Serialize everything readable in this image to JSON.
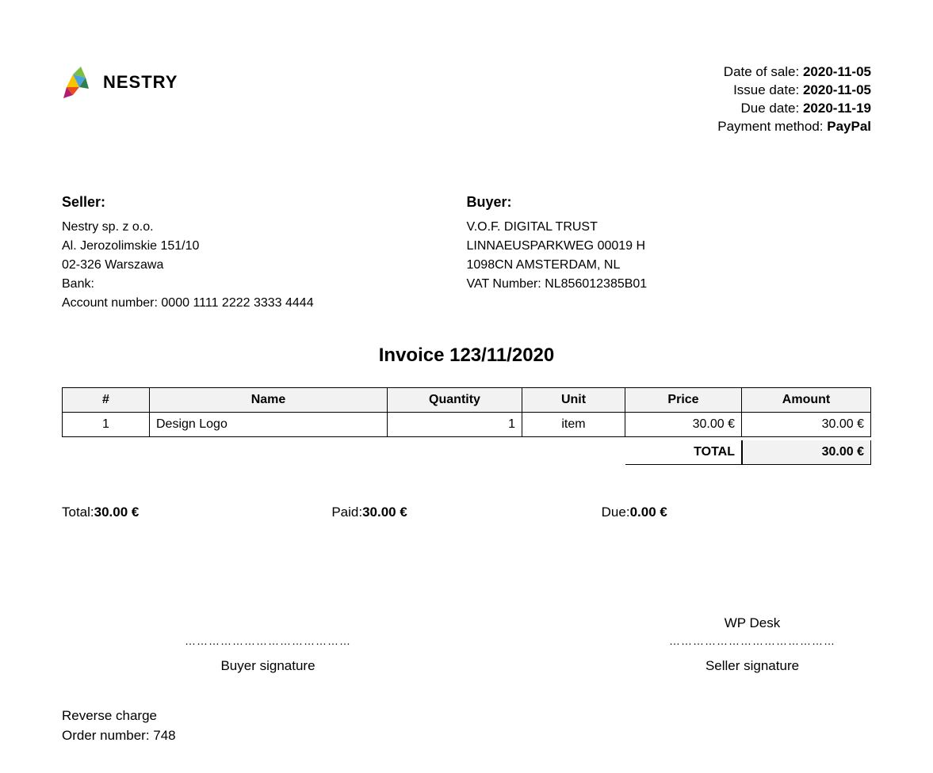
{
  "company": {
    "logo_text": "NESTRY"
  },
  "meta": {
    "date_of_sale": {
      "label": "Date of sale: ",
      "value": "2020-11-05"
    },
    "issue_date": {
      "label": "Issue date: ",
      "value": "2020-11-05"
    },
    "due_date": {
      "label": "Due date: ",
      "value": "2020-11-19"
    },
    "payment": {
      "label": "Payment method: ",
      "value": "PayPal"
    }
  },
  "seller": {
    "title": "Seller:",
    "lines": [
      "Nestry sp. z o.o.",
      "Al. Jerozolimskie 151/10",
      "02-326 Warszawa",
      "Bank:",
      "Account number: 0000 1111 2222 3333 4444"
    ]
  },
  "buyer": {
    "title": "Buyer:",
    "lines": [
      "V.O.F. DIGITAL TRUST",
      "LINNAEUSPARKWEG 00019 H",
      "1098CN AMSTERDAM, NL",
      "VAT Number: NL856012385B01"
    ]
  },
  "invoice_title": "Invoice 123/11/2020",
  "columns": {
    "num": "#",
    "name": "Name",
    "qty": "Quantity",
    "unit": "Unit",
    "price": "Price",
    "amount": "Amount"
  },
  "items": [
    {
      "num": "1",
      "name": "Design Logo",
      "qty": "1",
      "unit": "item",
      "price": "30.00 €",
      "amount": "30.00 €"
    }
  ],
  "total": {
    "label": "TOTAL",
    "value": "30.00 €"
  },
  "summary": {
    "total": {
      "label": "Total:",
      "value": "30.00 €"
    },
    "paid": {
      "label": "Paid:",
      "value": "30.00 €"
    },
    "due": {
      "label": "Due:",
      "value": "0.00 €"
    }
  },
  "sign": {
    "seller_name": "WP Desk",
    "dots": "……………………………………",
    "buyer_label": "Buyer signature",
    "seller_label": "Seller signature"
  },
  "footer": {
    "reverse_charge": "Reverse charge",
    "order_number": "Order number: 748"
  }
}
